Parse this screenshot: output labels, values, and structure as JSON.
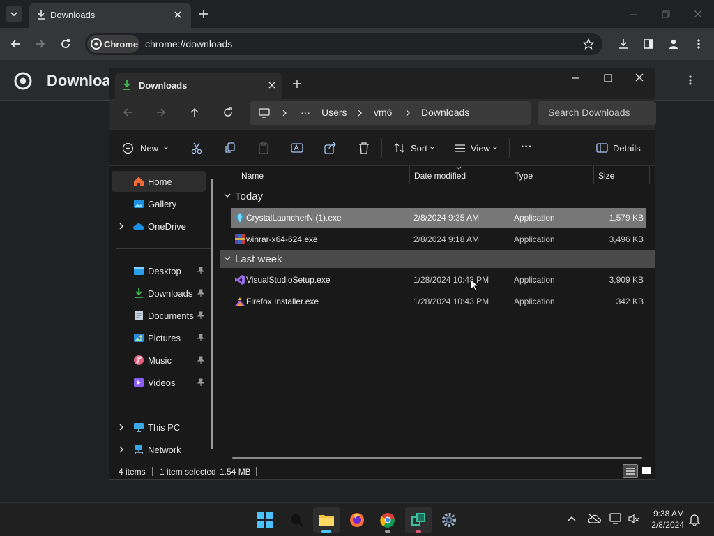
{
  "chrome": {
    "tab_title": "Downloads",
    "chip_label": "Chrome",
    "url": "chrome://downloads",
    "page_title": "Downloa"
  },
  "explorer": {
    "tab_title": "Downloads",
    "breadcrumb": [
      "Users",
      "vm6",
      "Downloads"
    ],
    "breadcrumb_more": "···",
    "search_placeholder": "Search Downloads",
    "commands": {
      "new": "New",
      "sort": "Sort",
      "view": "View",
      "more": "···",
      "details": "Details"
    },
    "nav": {
      "home": "Home",
      "gallery": "Gallery",
      "onedrive": "OneDrive",
      "desktop": "Desktop",
      "downloads": "Downloads",
      "documents": "Documents",
      "pictures": "Pictures",
      "music": "Music",
      "videos": "Videos",
      "thispc": "This PC",
      "network": "Network"
    },
    "columns": {
      "name": "Name",
      "date": "Date modified",
      "type": "Type",
      "size": "Size"
    },
    "groups": [
      {
        "label": "Today",
        "files": [
          {
            "name": "CrystalLauncherN (1).exe",
            "date": "2/8/2024 9:35 AM",
            "type": "Application",
            "size": "1,579 KB",
            "icon": "crystal-launcher-icon"
          },
          {
            "name": "winrar-x64-624.exe",
            "date": "2/8/2024 9:18 AM",
            "type": "Application",
            "size": "3,496 KB",
            "icon": "winrar-icon"
          }
        ]
      },
      {
        "label": "Last week",
        "files": [
          {
            "name": "VisualStudioSetup.exe",
            "date": "1/28/2024 10:48 PM",
            "type": "Application",
            "size": "3,909 KB",
            "icon": "visual-studio-icon"
          },
          {
            "name": "Firefox Installer.exe",
            "date": "1/28/2024 10:43 PM",
            "type": "Application",
            "size": "342 KB",
            "icon": "firefox-installer-icon"
          }
        ]
      }
    ],
    "status": {
      "items": "4 items",
      "selected": "1 item selected",
      "size": "1.54 MB"
    }
  },
  "taskbar": {
    "time": "9:38 AM",
    "date": "2/8/2024"
  },
  "colors": {
    "accent": "#4cc2ff",
    "selection": "#777777",
    "folder": "#f4c542"
  }
}
